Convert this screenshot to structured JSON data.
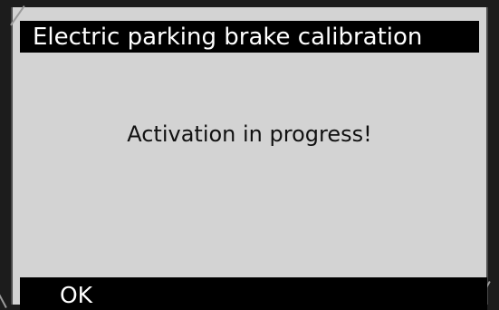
{
  "dialog": {
    "title": "Electric parking brake calibration",
    "message": "Activation in progress!"
  },
  "footer": {
    "ok_label": "OK"
  },
  "colors": {
    "screen_background": "#d3d3d3",
    "bar_background": "#000000",
    "bar_text": "#ffffff",
    "message_text": "#111111"
  }
}
